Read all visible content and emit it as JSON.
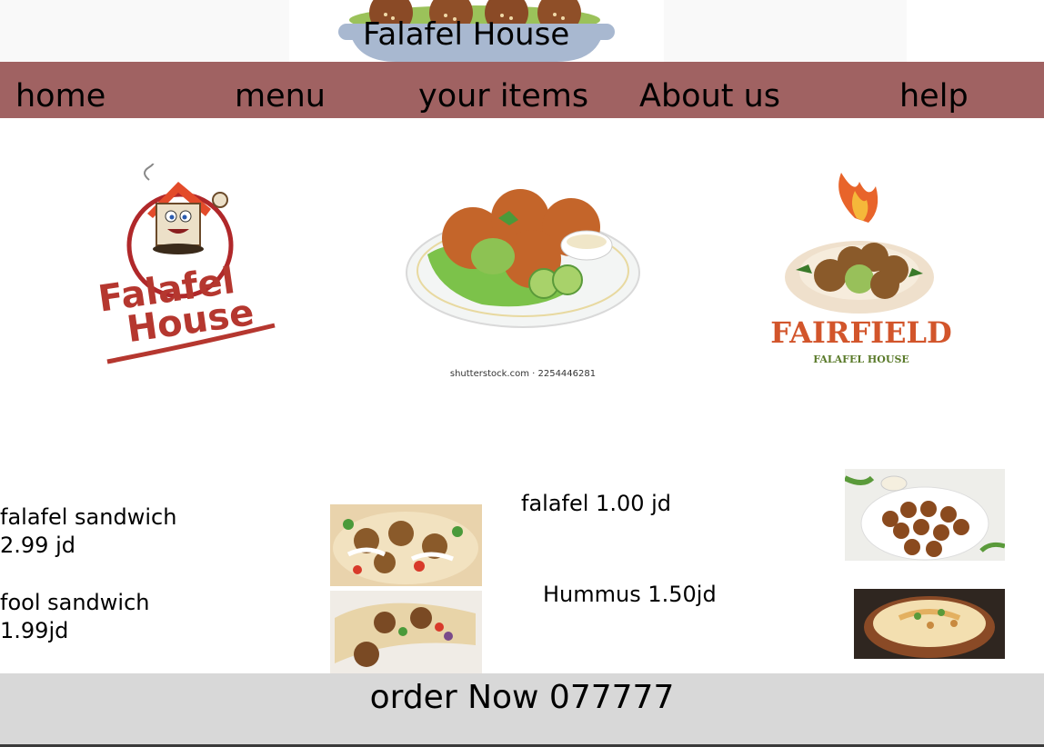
{
  "header": {
    "title": "Falafel House"
  },
  "nav": {
    "items": [
      "home",
      "menu",
      "your items",
      "About us",
      "help"
    ]
  },
  "logos": {
    "left": {
      "line1": "Falafel",
      "line2": "House"
    },
    "center": {
      "credit": "shutterstock.com · 2254446281"
    },
    "right": {
      "brand": "FAIRFIELD",
      "subtitle": "FALAFEL HOUSE"
    }
  },
  "menu": {
    "items": [
      {
        "text": "falafel sandwich\n2.99 jd"
      },
      {
        "text": "fool sandwich\n1.99jd"
      },
      {
        "text": "falafel 1.00 jd"
      },
      {
        "text": "Hummus 1.50jd"
      }
    ]
  },
  "footer": {
    "cta": "order Now 077777"
  },
  "colors": {
    "nav_bg": "#a06262",
    "footer_bg": "#d8d8d8",
    "brand_red": "#b5372f",
    "brand_orange": "#d2552b"
  }
}
